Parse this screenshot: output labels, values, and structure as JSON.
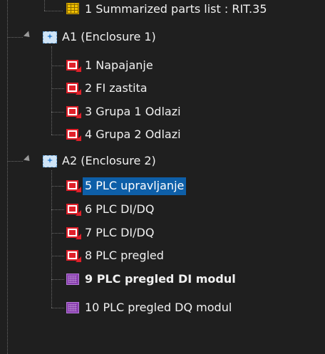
{
  "tree": {
    "top_item": {
      "label": "1 Summarized parts list : RIT.35"
    },
    "enclosure_1": {
      "label": "A1 (Enclosure 1)",
      "pages": [
        {
          "label": "1 Napajanje"
        },
        {
          "label": "2 FI zastita"
        },
        {
          "label": "3 Grupa 1 Odlazi"
        },
        {
          "label": "4 Grupa 2 Odlazi"
        }
      ]
    },
    "enclosure_2": {
      "label": "A2 (Enclosure 2)",
      "pages": [
        {
          "label": "5 PLC upravljanje",
          "selected": true
        },
        {
          "label": "6 PLC DI/DQ"
        },
        {
          "label": "7 PLC DI/DQ"
        },
        {
          "label": "8 PLC pregled"
        },
        {
          "label": "9 PLC pregled DI modul",
          "bold": true
        },
        {
          "label": "10 PLC pregled DQ modul"
        }
      ]
    }
  },
  "colors": {
    "background": "#1f1f1f",
    "selection": "#0e5fa8",
    "text": "#f0f0f0",
    "page_icon": "#e0202a",
    "graphic_icon": "#8a3fb0",
    "list_icon": "#f2c100",
    "enclosure_icon": "#cfe4f6"
  },
  "icons": {
    "enclosure": "enclosure-icon",
    "schematic_page": "schematic-page-icon",
    "graphic_page": "graphic-page-icon",
    "parts_list": "parts-list-icon",
    "expander": "expanded-arrow-icon"
  }
}
